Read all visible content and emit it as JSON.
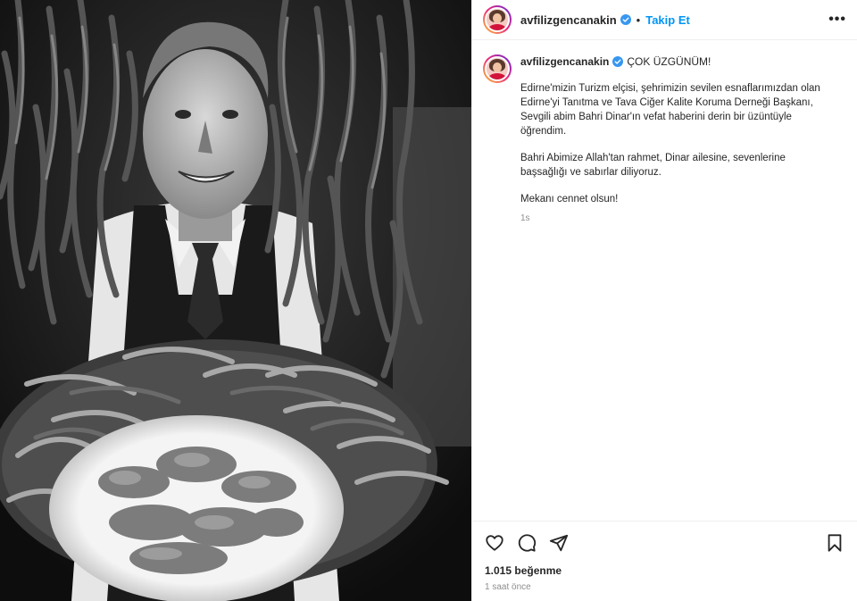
{
  "post": {
    "username": "avfilizgencanakin",
    "follow_label": "Takip Et",
    "more_label": "•••",
    "caption": {
      "title": "ÇOK ÜZGÜNÜM!",
      "paragraphs": [
        "Edirne'mizin Turizm elçisi, şehrimizin sevilen esnaflarımızdan olan\nEdirne'yi Tanıtma ve Tava Ciğer Kalite Koruma Derneği Başkanı,\nSevgili abim Bahri Dinar'ın vefat haberini derin bir üzüntüyle\nöğrendim.",
        "Bahri Abimize Allah'tan rahmet, Dinar ailesine, sevenlerine\nbaşsağlığı ve sabırlar diliyoruz.",
        "Mekanı cennet olsun!"
      ],
      "age": "1s"
    },
    "likes": "1.015 beğenme",
    "posted_ago": "1 saat önce"
  },
  "icons": {
    "verified": "verified-badge-icon",
    "like": "heart-icon",
    "comment": "comment-icon",
    "share": "share-icon",
    "save": "bookmark-icon",
    "more": "more-options-icon"
  },
  "colors": {
    "follow": "#0095f6",
    "verified": "#3897f0",
    "text": "#262626",
    "muted": "#8e8e8e"
  }
}
